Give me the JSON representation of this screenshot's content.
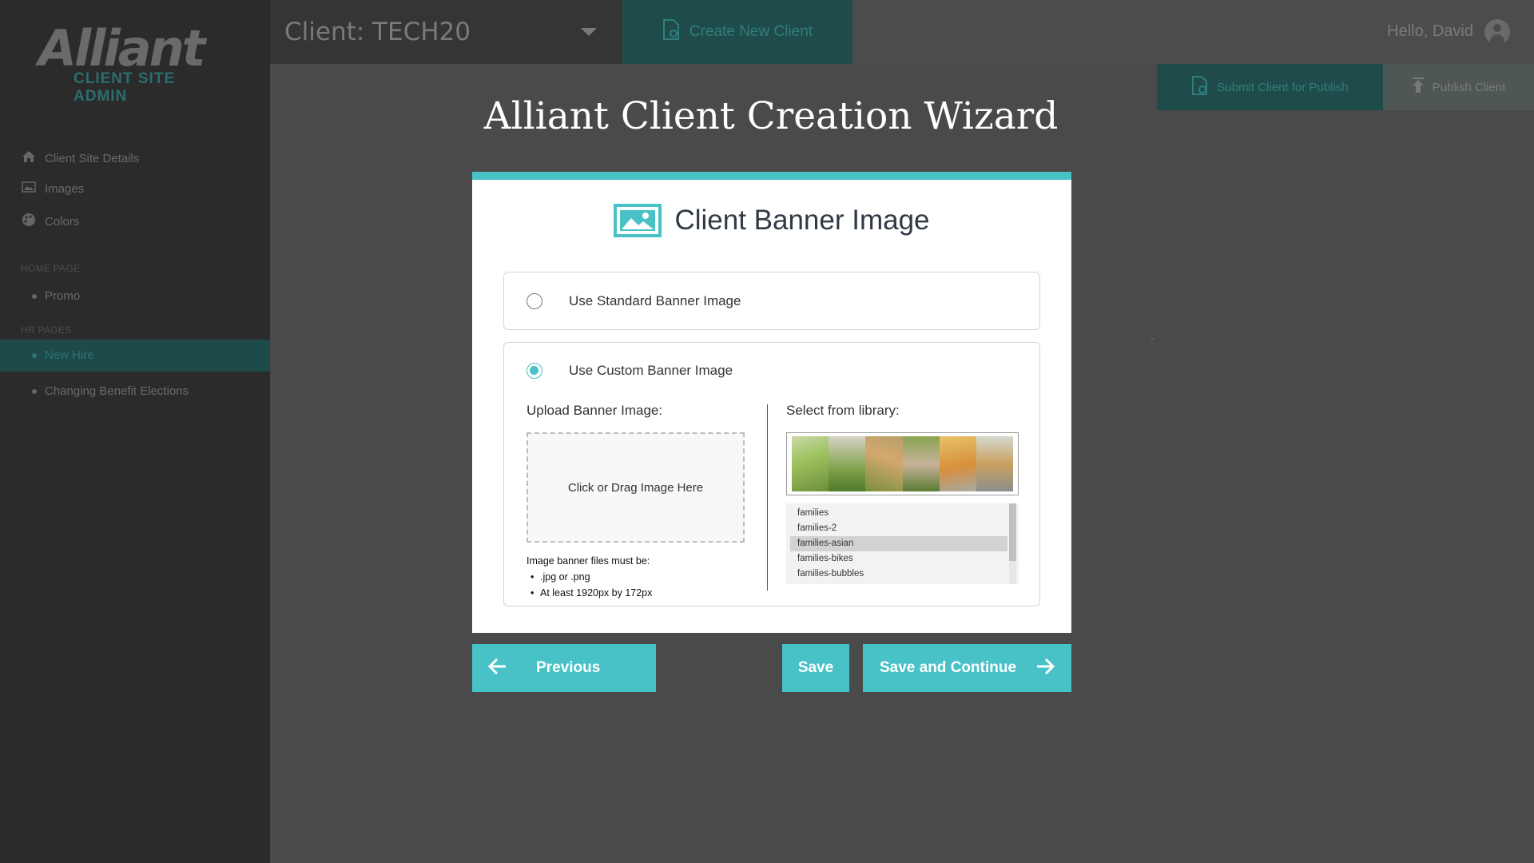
{
  "app": {
    "logo_text": "Alliant",
    "logo_subtitle": "CLIENT SITE ADMIN"
  },
  "sidebar": {
    "items": [
      {
        "label": "Client Site Details",
        "icon": "home-icon"
      },
      {
        "label": "Images",
        "icon": "image-icon"
      },
      {
        "label": "Colors",
        "icon": "palette-icon"
      }
    ],
    "sections": [
      {
        "title": "HOME PAGE",
        "items": [
          "Promo"
        ]
      },
      {
        "title": "HR PAGES",
        "items": [
          "New Hire",
          "Changing Benefit Elections"
        ]
      }
    ],
    "active_item": "New Hire"
  },
  "header": {
    "client_label": "Client: TECH20",
    "create_button": "Create New Client",
    "greeting": "Hello, David",
    "submit_button": "Submit Client for Publish",
    "publish_button": "Publish Client"
  },
  "wizard": {
    "title": "Alliant Client Creation Wizard",
    "card_title": "Client Banner Image",
    "option_standard": "Use Standard Banner Image",
    "option_custom": "Use Custom Banner Image",
    "selected_option": "custom",
    "upload_heading": "Upload Banner Image:",
    "dropzone_text": "Click or Drag Image Here",
    "requirements_heading": "Image banner files must be:",
    "requirements": [
      ".jpg or .png",
      "At least 1920px by 172px"
    ],
    "library_heading": "Select from library:",
    "library_items": [
      "families",
      "families-2",
      "families-asian",
      "families-bikes",
      "families-bubbles"
    ],
    "library_selected": "families-asian",
    "previous_button": "Previous",
    "save_button": "Save",
    "save_continue_button": "Save and Continue"
  },
  "colors": {
    "accent": "#49c2c7",
    "overlay_dark": "#2b2b2b"
  }
}
